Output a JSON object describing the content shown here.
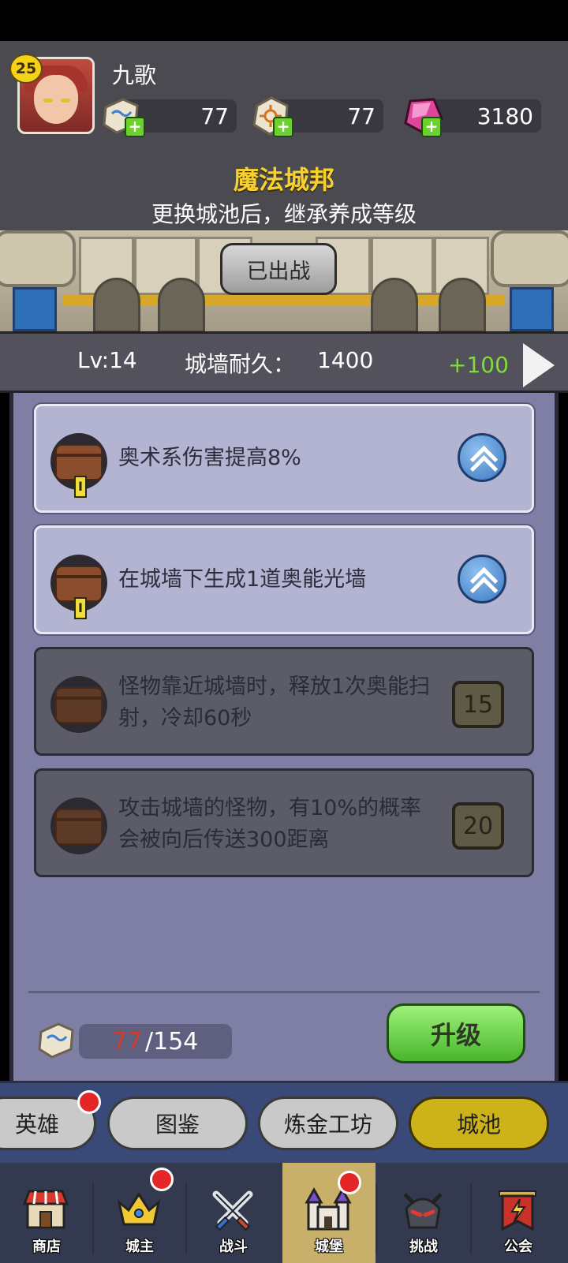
{
  "player": {
    "name": "九歌",
    "level": "25",
    "resources": [
      {
        "icon": "rune-stone-icon",
        "value": "77"
      },
      {
        "icon": "sun-stone-icon",
        "value": "77"
      },
      {
        "icon": "gem-icon",
        "value": "3180"
      }
    ]
  },
  "castle": {
    "title": "魔法城邦",
    "description": "更换城池后，继承养成等级",
    "deployed_label": "已出战"
  },
  "stats": {
    "level": "Lv:14",
    "durability_label": "城墙耐久：",
    "durability_value": "1400",
    "durability_bonus": "+100"
  },
  "skills": [
    {
      "text": "奥术系伤害提高8%",
      "tier": "I",
      "state": "active"
    },
    {
      "text": "在城墙下生成1道奥能光墙",
      "tier": "I",
      "state": "active"
    },
    {
      "text": "怪物靠近城墙时，释放1次奥能扫射，冷却60秒",
      "unlock_level": "15",
      "state": "locked"
    },
    {
      "text": "攻击城墙的怪物，有10%的概率会被向后传送300距离",
      "unlock_level": "20",
      "state": "locked"
    }
  ],
  "upgrade": {
    "cost_current": "77",
    "cost_required": "/154",
    "button_label": "升级"
  },
  "tabs": [
    {
      "label": "英雄",
      "badge": true
    },
    {
      "label": "图鉴"
    },
    {
      "label": "炼金工坊"
    },
    {
      "label": "城池",
      "selected": true
    }
  ],
  "bottom_nav": [
    {
      "label": "商店",
      "icon": "shop-icon"
    },
    {
      "label": "城主",
      "icon": "crown-icon",
      "badge": true
    },
    {
      "label": "战斗",
      "icon": "crossed-swords-icon"
    },
    {
      "label": "城堡",
      "icon": "castle-icon",
      "badge": true,
      "selected": true
    },
    {
      "label": "挑战",
      "icon": "demon-helmet-icon"
    },
    {
      "label": "公会",
      "icon": "guild-banner-icon"
    }
  ],
  "colors": {
    "gold_title": "#f6d130",
    "green_bonus": "#7fdc3a",
    "cost_red": "#d53a2c"
  }
}
